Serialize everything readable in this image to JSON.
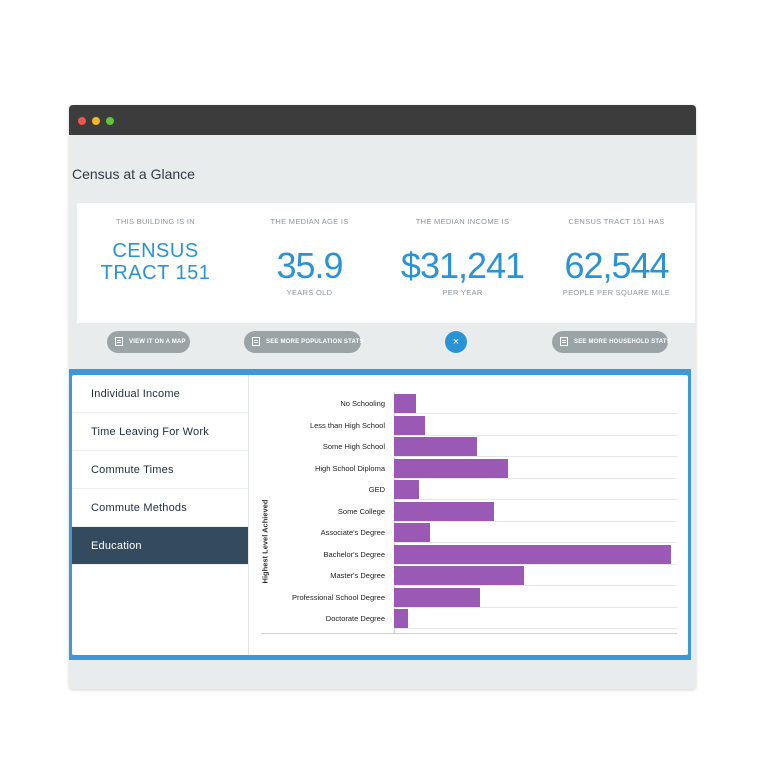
{
  "page": {
    "title": "Census at a Glance"
  },
  "cards": [
    {
      "caption": "THIS BUILDING IS IN",
      "value_line1": "CENSUS",
      "value_line2": "TRACT 151",
      "sub": ""
    },
    {
      "caption": "THE MEDIAN AGE IS",
      "value": "35.9",
      "sub": "YEARS OLD"
    },
    {
      "caption": "THE MEDIAN INCOME IS",
      "value": "$31,241",
      "sub": "PER YEAR"
    },
    {
      "caption": "CENSUS TRACT 151 HAS",
      "value": "62,544",
      "sub": "PEOPLE PER SQUARE MILE"
    }
  ],
  "buttons": {
    "map": "VIEW IT ON A MAP",
    "population": "SEE MORE POPULATION STATS",
    "close": "×",
    "household": "SEE MORE HOUSEHOLD STATS"
  },
  "menu": [
    {
      "label": "Individual Income",
      "active": false
    },
    {
      "label": "Time Leaving For Work",
      "active": false
    },
    {
      "label": "Commute Times",
      "active": false
    },
    {
      "label": "Commute Methods",
      "active": false
    },
    {
      "label": "Education",
      "active": true
    }
  ],
  "chart_data": {
    "type": "bar",
    "orientation": "horizontal",
    "ylabel": "Highest Level Achieved",
    "categories": [
      "No Schooling",
      "Less than High School",
      "Some High School",
      "High School Diploma",
      "GED",
      "Some College",
      "Associate's Degree",
      "Bachelor's Degree",
      "Master's Degree",
      "Professional School Degree",
      "Doctorate Degree"
    ],
    "values": [
      8,
      11,
      30,
      41,
      9,
      36,
      13,
      100,
      47,
      31,
      5
    ],
    "xlim": [
      0,
      102
    ],
    "bar_color": "#9b59b6",
    "grid": true
  },
  "colors": {
    "accent": "#2a93d5",
    "panel_border": "#3d97d8",
    "active_menu": "#344a5f"
  }
}
